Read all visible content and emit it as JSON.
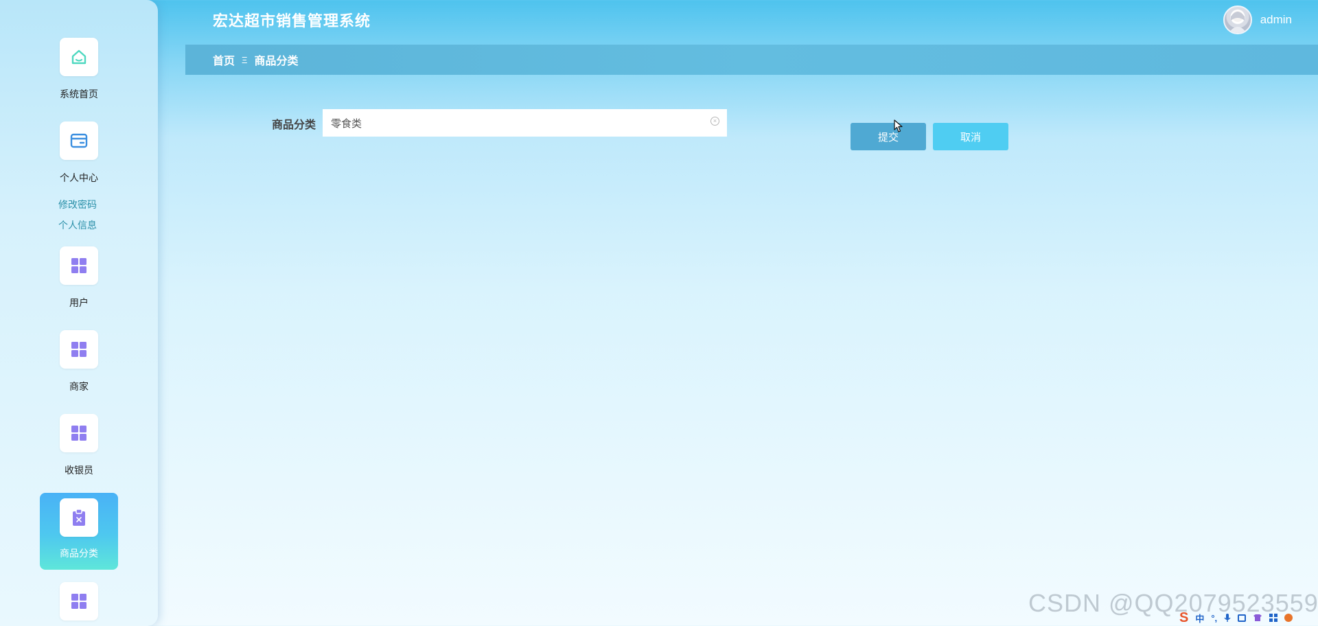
{
  "header": {
    "title": "宏达超市销售管理系统",
    "username": "admin"
  },
  "sidebar": {
    "items": [
      {
        "label": "系统首页",
        "icon": "home-icon"
      },
      {
        "label": "个人中心",
        "icon": "wallet-icon"
      },
      {
        "label": "用户",
        "icon": "grid-icon"
      },
      {
        "label": "商家",
        "icon": "grid-icon"
      },
      {
        "label": "收银员",
        "icon": "grid-icon"
      },
      {
        "label": "商品分类",
        "icon": "clipboard-icon",
        "active": true
      },
      {
        "label": "",
        "icon": "grid-icon"
      }
    ],
    "submenu": [
      "修改密码",
      "个人信息"
    ]
  },
  "breadcrumb": {
    "home": "首页",
    "separator": "Ξ",
    "current": "商品分类"
  },
  "form": {
    "category_label": "商品分类",
    "category_value": "零食类",
    "submit_label": "提交",
    "cancel_label": "取消"
  },
  "watermark": "CSDN @QQ2079523559",
  "tray": {
    "input_mode": "中",
    "punct": "°,"
  },
  "colors": {
    "accent": "#4ec3ee",
    "submit": "#4fa9d3",
    "cancel": "#4fcdf2",
    "icon_green": "#4ed8c0",
    "icon_blue": "#3b8fe0",
    "icon_purple": "#8f7ef0"
  }
}
